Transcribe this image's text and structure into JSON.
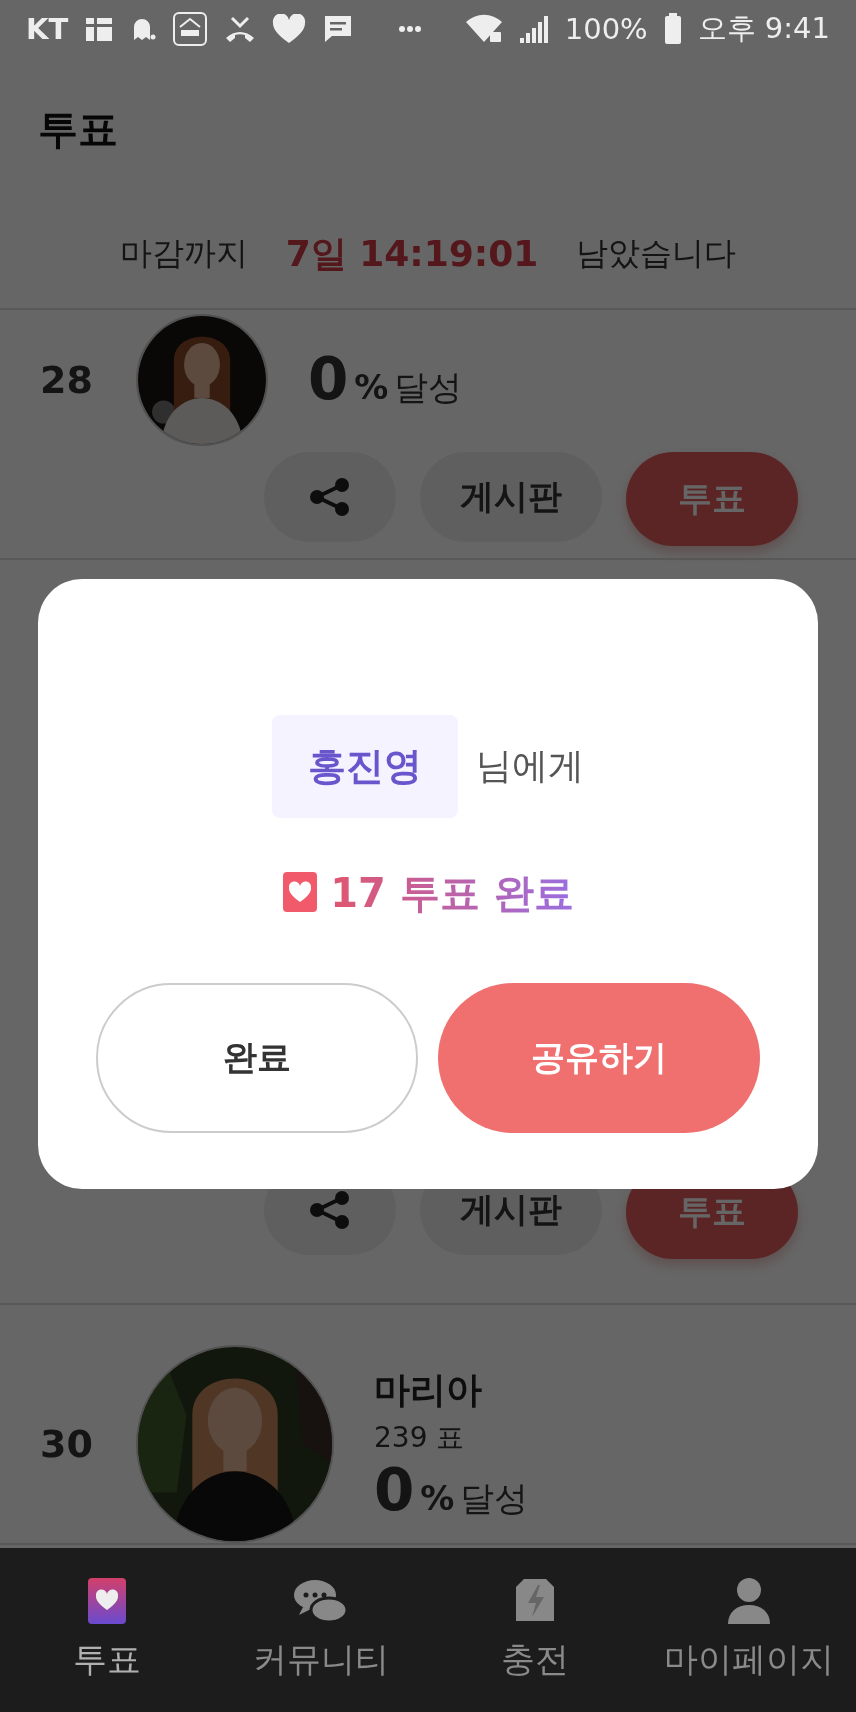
{
  "status_bar": {
    "carrier": "KT",
    "battery": "100%",
    "time": "오후 9:41"
  },
  "header": {
    "title": "투표"
  },
  "countdown": {
    "prefix": "마감까지",
    "remaining": "7일 14:19:01",
    "suffix": "남았습니다"
  },
  "candidates": [
    {
      "rank": "28",
      "percent": "0",
      "unit": "%",
      "label": "달성",
      "board": "게시판",
      "vote": "투표"
    },
    {
      "board": "게시판",
      "vote": "투표"
    },
    {
      "rank": "30",
      "name": "마리아",
      "votes": "239 표",
      "percent": "0",
      "unit": "%",
      "label": "달성"
    }
  ],
  "dialog": {
    "recipient": "홍진영",
    "recipient_suffix": "님에게",
    "result": "17 투표 완료",
    "buttons": [
      {
        "label": "완료",
        "kind": "outline"
      },
      {
        "label": "공유하기",
        "kind": "primary"
      }
    ]
  },
  "bottom_nav": [
    {
      "label": "투표",
      "kind": "vote",
      "selected": true
    },
    {
      "label": "커뮤니티",
      "kind": "community",
      "selected": false
    },
    {
      "label": "충전",
      "kind": "charge",
      "selected": false
    },
    {
      "label": "마이페이지",
      "kind": "mypage",
      "selected": false
    }
  ]
}
